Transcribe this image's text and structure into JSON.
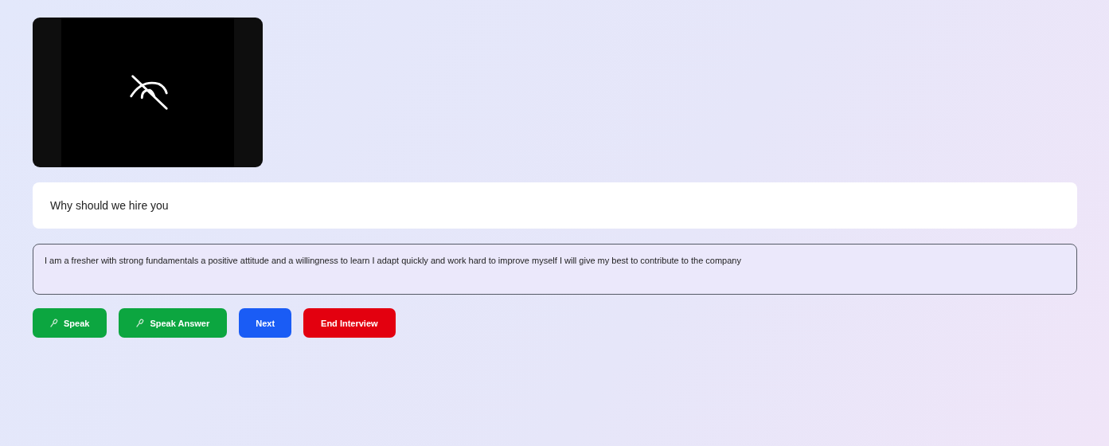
{
  "video": {
    "camera_off": true
  },
  "question": "Why should we hire you",
  "answer": {
    "value": "I am a fresher with strong fundamentals a positive attitude and a willingness to learn I adapt quickly and work hard to improve myself I will give my best to contribute to the company"
  },
  "buttons": [
    {
      "label": "Speak",
      "kind": "mic",
      "color": "#0ca640"
    },
    {
      "label": "Speak Answer",
      "kind": "mic",
      "color": "#0ca640"
    },
    {
      "label": "Next",
      "kind": "plain",
      "color": "#1a5cf5"
    },
    {
      "label": "End Interview",
      "kind": "plain",
      "color": "#e3000f"
    }
  ]
}
